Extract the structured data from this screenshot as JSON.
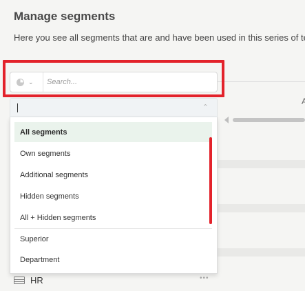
{
  "header": {
    "title": "Manage segments",
    "subtitle": "Here you see all segments that are and have been used in this series of tes"
  },
  "search": {
    "placeholder": "Search...",
    "segment_toggle_icon": "pie-chart-icon"
  },
  "select": {
    "value": ""
  },
  "dropdown": {
    "options": [
      {
        "label": "All segments",
        "selected": true
      },
      {
        "label": "Own segments",
        "selected": false
      },
      {
        "label": "Additional segments",
        "selected": false
      },
      {
        "label": "Hidden segments",
        "selected": false
      },
      {
        "label": "All + Hidden segments",
        "selected": false
      },
      {
        "label": "Superior",
        "selected": false
      },
      {
        "label": "Department",
        "selected": false
      }
    ]
  },
  "background_table": {
    "header_fragment": "A",
    "rows": [
      {
        "label": "HR",
        "icon": "table-icon",
        "menu": "•••"
      }
    ]
  },
  "colors": {
    "highlight": "#e3222b",
    "selected_option_bg": "#eaf3ec",
    "page_bg": "#f5f5f3"
  }
}
